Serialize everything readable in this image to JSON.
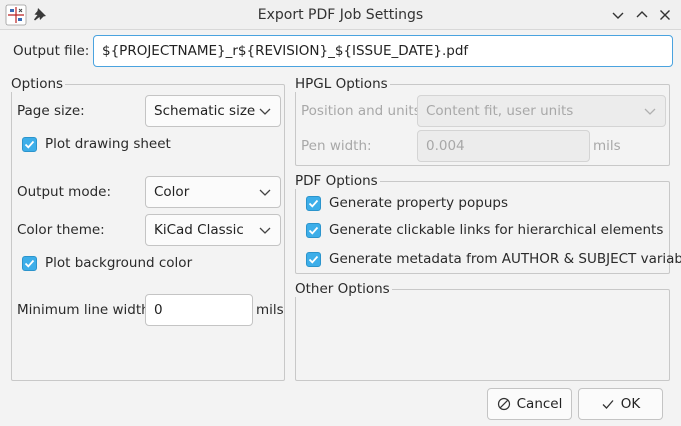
{
  "window": {
    "title": "Export PDF Job Settings"
  },
  "output_file": {
    "label": "Output file:",
    "value": "${PROJECTNAME}_r${REVISION}_${ISSUE_DATE}.pdf"
  },
  "options": {
    "title": "Options",
    "page_size": {
      "label": "Page size:",
      "value": "Schematic size"
    },
    "plot_drawing_sheet": {
      "label": "Plot drawing sheet",
      "checked": true
    },
    "output_mode": {
      "label": "Output mode:",
      "value": "Color"
    },
    "color_theme": {
      "label": "Color theme:",
      "value": "KiCad Classic"
    },
    "plot_background": {
      "label": "Plot background color",
      "checked": true
    },
    "min_line_width": {
      "label": "Minimum line width:",
      "value": "0",
      "unit": "mils"
    }
  },
  "hpgl": {
    "title": "HPGL Options",
    "position_units": {
      "label": "Position and units:",
      "value": "Content fit, user units"
    },
    "pen_width": {
      "label": "Pen width:",
      "value": "0.004",
      "unit": "mils"
    }
  },
  "pdf": {
    "title": "PDF Options",
    "property_popups": {
      "label": "Generate property popups",
      "checked": true
    },
    "clickable_links": {
      "label": "Generate clickable links for hierarchical elements",
      "checked": true
    },
    "metadata": {
      "label": "Generate metadata from AUTHOR & SUBJECT variables",
      "checked": true
    }
  },
  "other": {
    "title": "Other Options"
  },
  "buttons": {
    "cancel": "Cancel",
    "ok": "OK"
  },
  "colors": {
    "accent": "#3daee9",
    "focus_border": "#4aa3df",
    "background": "#f3f3f3"
  }
}
